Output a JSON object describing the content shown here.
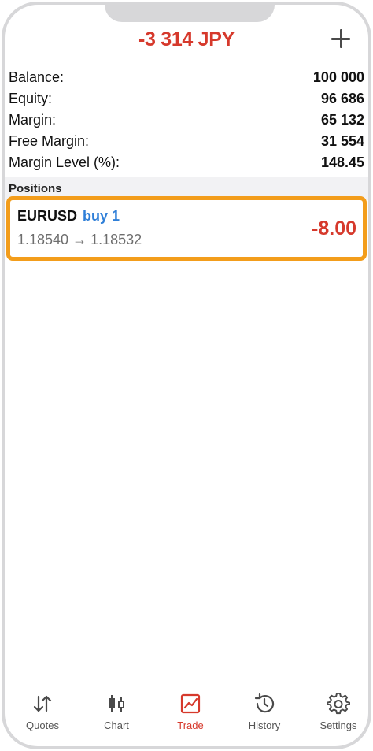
{
  "header": {
    "title": "-3 314 JPY",
    "add_icon": "plus-icon"
  },
  "account": {
    "rows": [
      {
        "label": "Balance:",
        "value": "100 000"
      },
      {
        "label": "Equity:",
        "value": "96 686"
      },
      {
        "label": "Margin:",
        "value": "65 132"
      },
      {
        "label": "Free Margin:",
        "value": "31 554"
      },
      {
        "label": "Margin Level (%):",
        "value": "148.45"
      }
    ]
  },
  "positions": {
    "section_title": "Positions",
    "items": [
      {
        "symbol": "EURUSD",
        "type": "buy 1",
        "open_price": "1.18540",
        "arrow": "→",
        "current_price": "1.18532",
        "profit": "-8.00"
      }
    ]
  },
  "tabbar": {
    "tabs": [
      {
        "label": "Quotes",
        "icon": "quotes-icon"
      },
      {
        "label": "Chart",
        "icon": "candlestick-chart-icon"
      },
      {
        "label": "Trade",
        "icon": "trade-chart-icon"
      },
      {
        "label": "History",
        "icon": "history-clock-icon"
      },
      {
        "label": "Settings",
        "icon": "gear-icon"
      }
    ],
    "active": "Trade"
  },
  "colors": {
    "profit_negative": "#d6392c",
    "buy": "#2f7fd8",
    "highlight_border": "#f39d1b",
    "active_tab": "#d6392c"
  }
}
